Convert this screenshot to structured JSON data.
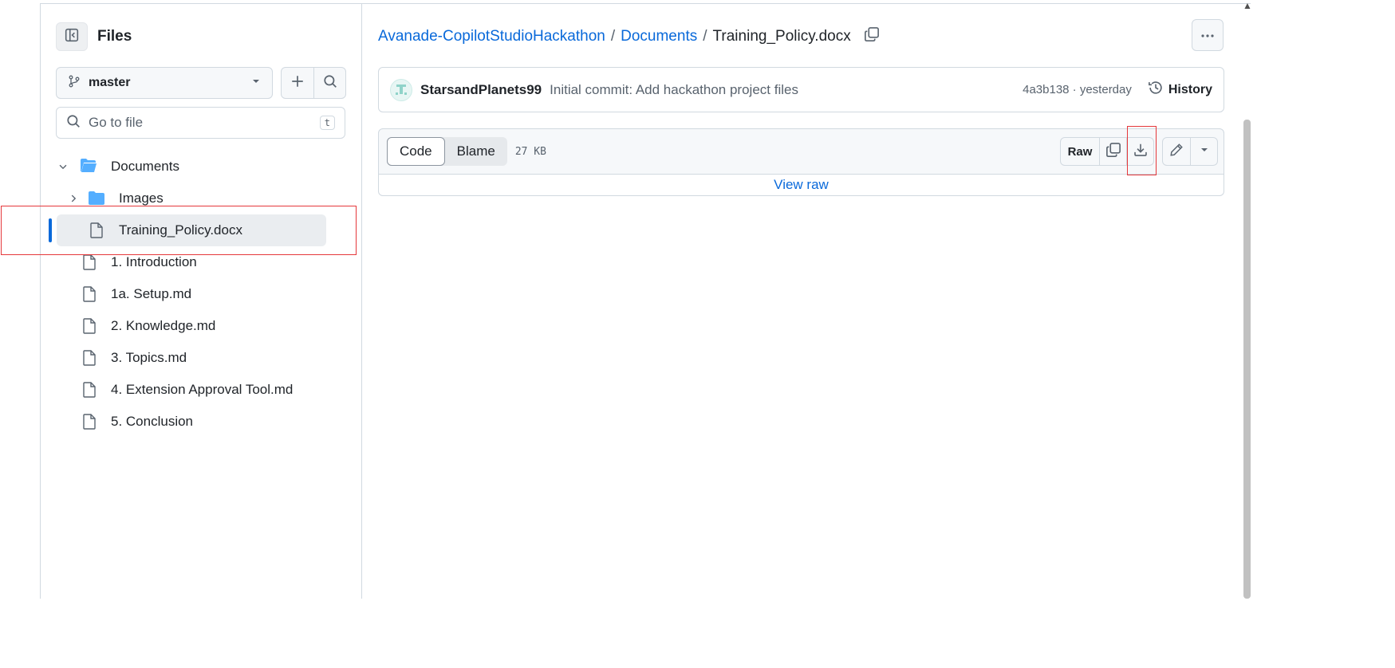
{
  "sidebar": {
    "title": "Files",
    "branch": "master",
    "search_placeholder": "Go to file",
    "search_shortcut": "t",
    "tree": [
      {
        "label": "Documents",
        "type": "folder",
        "expanded": true
      },
      {
        "label": "Images",
        "type": "folder",
        "expanded": false
      },
      {
        "label": "Training_Policy.docx",
        "type": "file",
        "selected": true
      },
      {
        "label": "1. Introduction",
        "type": "file"
      },
      {
        "label": "1a. Setup.md",
        "type": "file"
      },
      {
        "label": "2. Knowledge.md",
        "type": "file"
      },
      {
        "label": "3. Topics.md",
        "type": "file"
      },
      {
        "label": "4. Extension Approval Tool.md",
        "type": "file"
      },
      {
        "label": "5. Conclusion",
        "type": "file"
      }
    ]
  },
  "breadcrumb": {
    "repo": "Avanade-CopilotStudioHackathon",
    "folder": "Documents",
    "file": "Training_Policy.docx",
    "separator": "/"
  },
  "commit": {
    "author": "StarsandPlanets99",
    "message": "Initial commit: Add hackathon project files",
    "meta": "4a3b138 · yesterday",
    "history_label": "History"
  },
  "file_view": {
    "tabs": [
      "Code",
      "Blame"
    ],
    "active_tab": "Code",
    "size": "27 KB",
    "raw_label": "Raw",
    "view_raw": "View raw"
  },
  "colors": {
    "accent": "#0969da",
    "highlight": "#e5383b"
  }
}
